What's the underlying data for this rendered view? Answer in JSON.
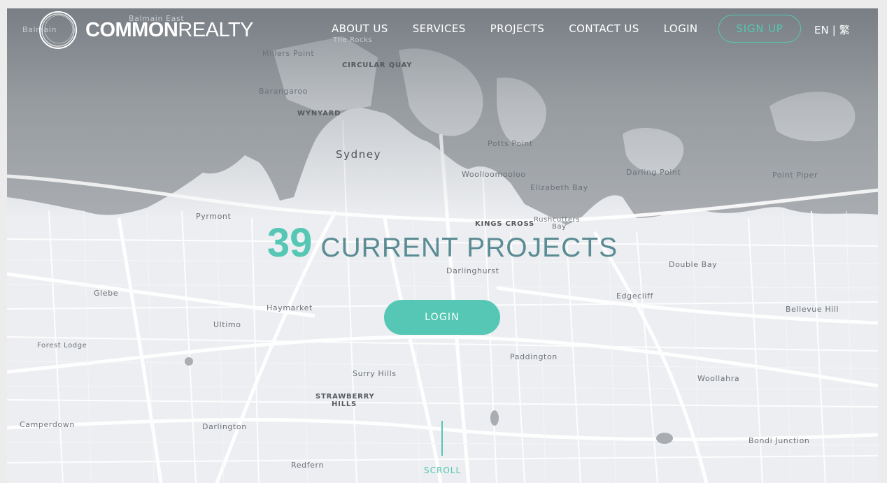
{
  "brand": {
    "name_bold": "COMMON",
    "name_light": "REALTY"
  },
  "nav": {
    "links": [
      "ABOUT US",
      "SERVICES",
      "PROJECTS",
      "CONTACT US",
      "LOGIN"
    ],
    "signup_label": "SIGN UP",
    "lang_en": "EN",
    "lang_sep": "|",
    "lang_tc": "繁"
  },
  "hero": {
    "count": "39",
    "title": "CURRENT PROJECTS",
    "login_label": "LOGIN"
  },
  "scroll_label": "SCROLL",
  "map_labels": {
    "balmain_east": "Balmain East",
    "balmain": "Balmain",
    "the_rocks": "The Rocks",
    "millers_point": "Millers Point",
    "circular_quay": "CIRCULAR QUAY",
    "barangaroo": "Barangaroo",
    "wynyard": "WYNYARD",
    "sydney": "Sydney",
    "potts_point": "Potts Point",
    "woolloomooloo": "Woolloomooloo",
    "darling_point": "Darling Point",
    "point_piper": "Point Piper",
    "elizabeth_bay": "Elizabeth Bay",
    "pyrmont": "Pyrmont",
    "kings_cross": "KINGS CROSS",
    "rushcutters": "Rushcutters",
    "bay": "Bay",
    "darlinghurst": "Darlinghurst",
    "double_bay": "Double Bay",
    "glebe": "Glebe",
    "haymarket": "Haymarket",
    "edgecliff": "Edgecliff",
    "bellevue_hill": "Bellevue Hill",
    "ultimo": "Ultimo",
    "forest_lodge": "Forest Lodge",
    "paddington": "Paddington",
    "surry_hills": "Surry Hills",
    "woollahra": "Woollahra",
    "strawberry": "STRAWBERRY",
    "hills": "HILLS",
    "camperdown": "Camperdown",
    "darlington": "Darlington",
    "bondi_junction": "Bondi Junction",
    "redfern": "Redfern"
  },
  "colors": {
    "accent": "#55c7b4",
    "title": "#5b8c94",
    "water": "#a9adb1",
    "land": "#eceef1"
  }
}
